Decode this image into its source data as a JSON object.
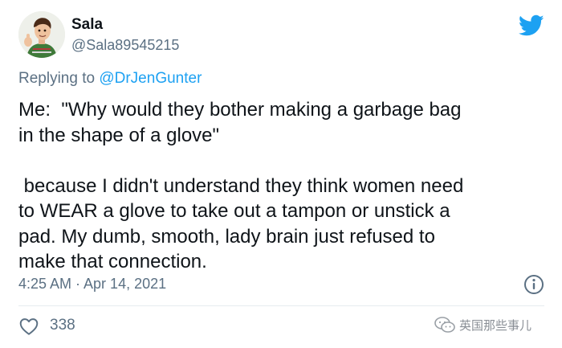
{
  "user": {
    "display_name": "Sala",
    "handle": "@Sala89545215",
    "avatar": "avatar-icon"
  },
  "reply": {
    "prefix": "Replying to ",
    "mention": "@DrJenGunter"
  },
  "tweet": {
    "text": "Me:  \"Why would they bother making a garbage bag\nin the shape of a glove\"\n\n because I didn't understand they think women need\nto WEAR a glove to take out a tampon or unstick a\npad. My dumb, smooth, lady brain just refused to\nmake that connection.",
    "timestamp": "4:25 AM · Apr 14, 2021",
    "like_count": "338"
  },
  "icons": {
    "brand": "twitter-bird-icon",
    "info": "info-icon",
    "like": "heart-icon",
    "watermark": "wechat-icon"
  },
  "watermark": {
    "text": "英国那些事儿"
  },
  "colors": {
    "text": "#0f1419",
    "secondary": "#5b7083",
    "accent": "#1da1f2",
    "divider": "#e6ecf0"
  }
}
